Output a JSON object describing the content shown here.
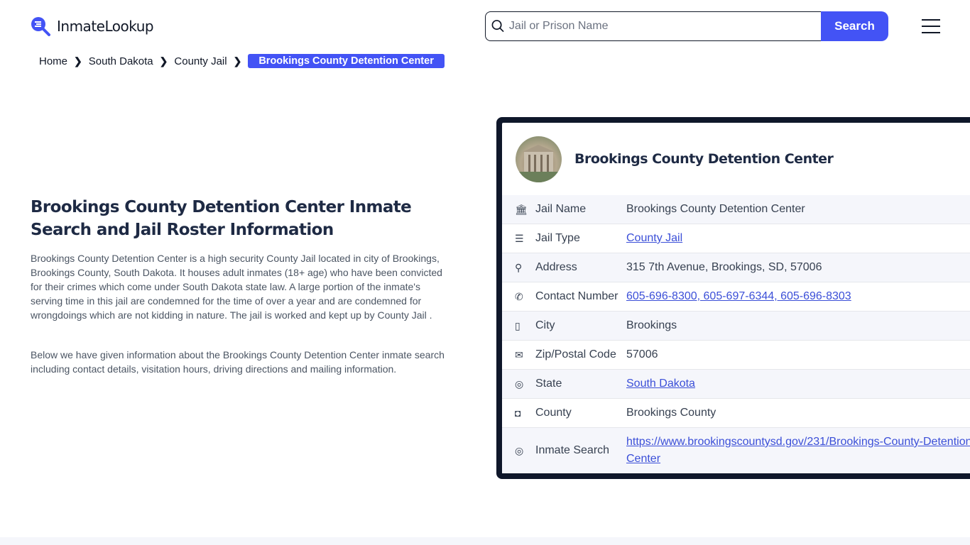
{
  "header": {
    "logo": "InmateLookup",
    "search_placeholder": "Jail or Prison Name",
    "search_button": "Search"
  },
  "breadcrumb": [
    "Home",
    "South Dakota",
    "County Jail",
    "Brookings County Detention Center"
  ],
  "main": {
    "title": "Brookings County Detention Center Inmate Search and Jail Roster Information",
    "p1": "Brookings County Detention Center is a high security County Jail located in city of Brookings, Brookings County, South Dakota. It houses adult inmates (18+ age) who have been convicted for their crimes which come under South Dakota state law. A large portion of the inmate's serving time in this jail are condemned for the time of over a year and are condemned for wrongdoings which are not kidding in nature. The jail is worked and kept up by County Jail .",
    "p2": "Below we have given information about the Brookings County Detention Center inmate search including contact details, visitation hours, driving directions and mailing information."
  },
  "card": {
    "title": "Brookings County Detention Center",
    "rows": [
      {
        "icon": "bank-icon",
        "label": "Jail Name",
        "value": "Brookings County Detention Center",
        "link": false
      },
      {
        "icon": "list-icon",
        "label": "Jail Type",
        "value": "County Jail",
        "link": true
      },
      {
        "icon": "map-pin-icon",
        "label": "Address",
        "value": "315 7th Avenue, Brookings, SD, 57006",
        "link": false
      },
      {
        "icon": "phone-icon",
        "label": "Contact Number",
        "value": "605-696-8300, 605-697-6344, 605-696-8303",
        "link": true
      },
      {
        "icon": "map-icon",
        "label": "City",
        "value": "Brookings",
        "link": false
      },
      {
        "icon": "mail-icon",
        "label": "Zip/Postal Code",
        "value": "57006",
        "link": false
      },
      {
        "icon": "globe-icon",
        "label": "State",
        "value": "South Dakota",
        "link": true
      },
      {
        "icon": "county-icon",
        "label": "County",
        "value": "Brookings County",
        "link": false
      },
      {
        "icon": "globe-icon",
        "label": "Inmate Search",
        "value": "https://www.brookingscountysd.gov/231/Brookings-County-Detention-Center",
        "link": true
      }
    ]
  },
  "colors": {
    "accent": "#4353f5",
    "card_border": "#0f172a"
  }
}
